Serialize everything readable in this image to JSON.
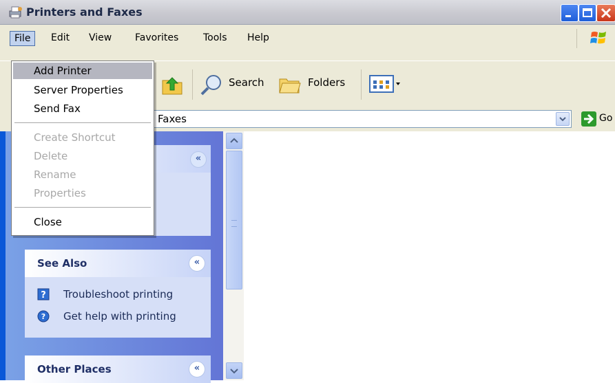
{
  "window": {
    "title": "Printers and Faxes",
    "colors": {
      "frame": "#0a58d8",
      "menubar": "#ecead8",
      "taskpane": "#6b86dc",
      "link": "#215dc6"
    }
  },
  "menubar": {
    "file": "File",
    "edit": "Edit",
    "view": "View",
    "favorites": "Favorites",
    "tools": "Tools",
    "help": "Help"
  },
  "toolbar": {
    "search": "Search",
    "folders": "Folders"
  },
  "address": {
    "value": "Faxes",
    "go": "Go"
  },
  "file_menu": {
    "items": [
      {
        "label": "Add Printer",
        "enabled": true,
        "highlighted": true
      },
      {
        "label": "Server Properties",
        "enabled": true
      },
      {
        "label": "Send Fax",
        "enabled": true
      },
      {
        "label": "Create Shortcut",
        "enabled": false
      },
      {
        "label": "Delete",
        "enabled": false
      },
      {
        "label": "Rename",
        "enabled": false
      },
      {
        "label": "Properties",
        "enabled": false
      },
      {
        "label": "Close",
        "enabled": true
      }
    ]
  },
  "taskpane": {
    "see_also": {
      "title": "See Also",
      "links": [
        {
          "label": "Troubleshoot printing",
          "icon": "help-question-icon"
        },
        {
          "label": "Get help with printing",
          "icon": "help-circle-icon"
        }
      ]
    },
    "other_places": {
      "title": "Other Places"
    }
  }
}
